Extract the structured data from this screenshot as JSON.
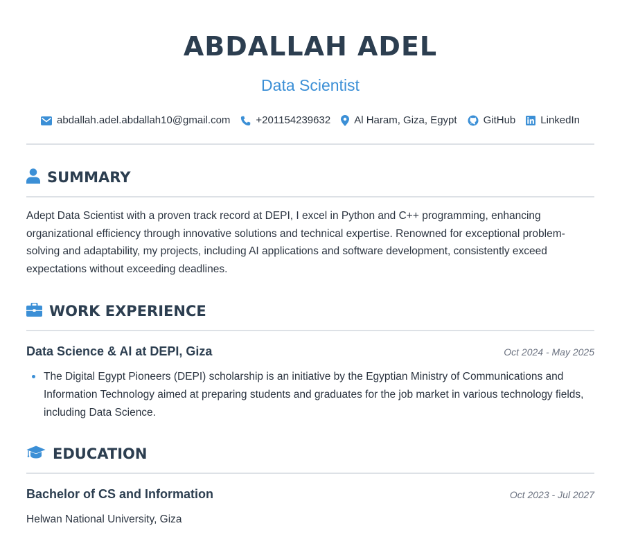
{
  "header": {
    "name": "ABDALLAH ADEL",
    "title": "Data Scientist",
    "contacts": [
      {
        "icon": "envelope-icon",
        "text": "abdallah.adel.abdallah10@gmail.com"
      },
      {
        "icon": "phone-icon",
        "text": "+201154239632"
      },
      {
        "icon": "map-pin-icon",
        "text": "Al Haram, Giza, Egypt"
      },
      {
        "icon": "github-icon",
        "text": "GitHub"
      },
      {
        "icon": "linkedin-icon",
        "text": "LinkedIn"
      }
    ]
  },
  "summary": {
    "heading": "SUMMARY",
    "icon": "user-icon",
    "text": "Adept Data Scientist with a proven track record at DEPI, I excel in Python and C++ programming, enhancing organizational efficiency through innovative solutions and technical expertise. Renowned for exceptional problem-solving and adaptability, my projects, including AI applications and software development, consistently exceed expectations without exceeding deadlines."
  },
  "experience": {
    "heading": "WORK EXPERIENCE",
    "icon": "briefcase-icon",
    "entries": [
      {
        "title": "Data Science & AI at DEPI, Giza",
        "date": "Oct 2024 - May 2025",
        "bullets": [
          "The Digital Egypt Pioneers (DEPI) scholarship is an initiative by the Egyptian Ministry of Communications and Information Technology aimed at preparing students and graduates for the job market in various technology fields, including Data Science."
        ]
      }
    ]
  },
  "education": {
    "heading": "EDUCATION",
    "icon": "graduation-cap-icon",
    "entries": [
      {
        "degree": "Bachelor of CS and Information",
        "date": "Oct 2023 - Jul 2027",
        "institution": "Helwan National University, Giza"
      }
    ]
  },
  "colors": {
    "accent": "#3b8fd6",
    "heading": "#2c3e50",
    "text": "#2b3440",
    "rule": "#dde1e6",
    "muted": "#6b7280"
  }
}
